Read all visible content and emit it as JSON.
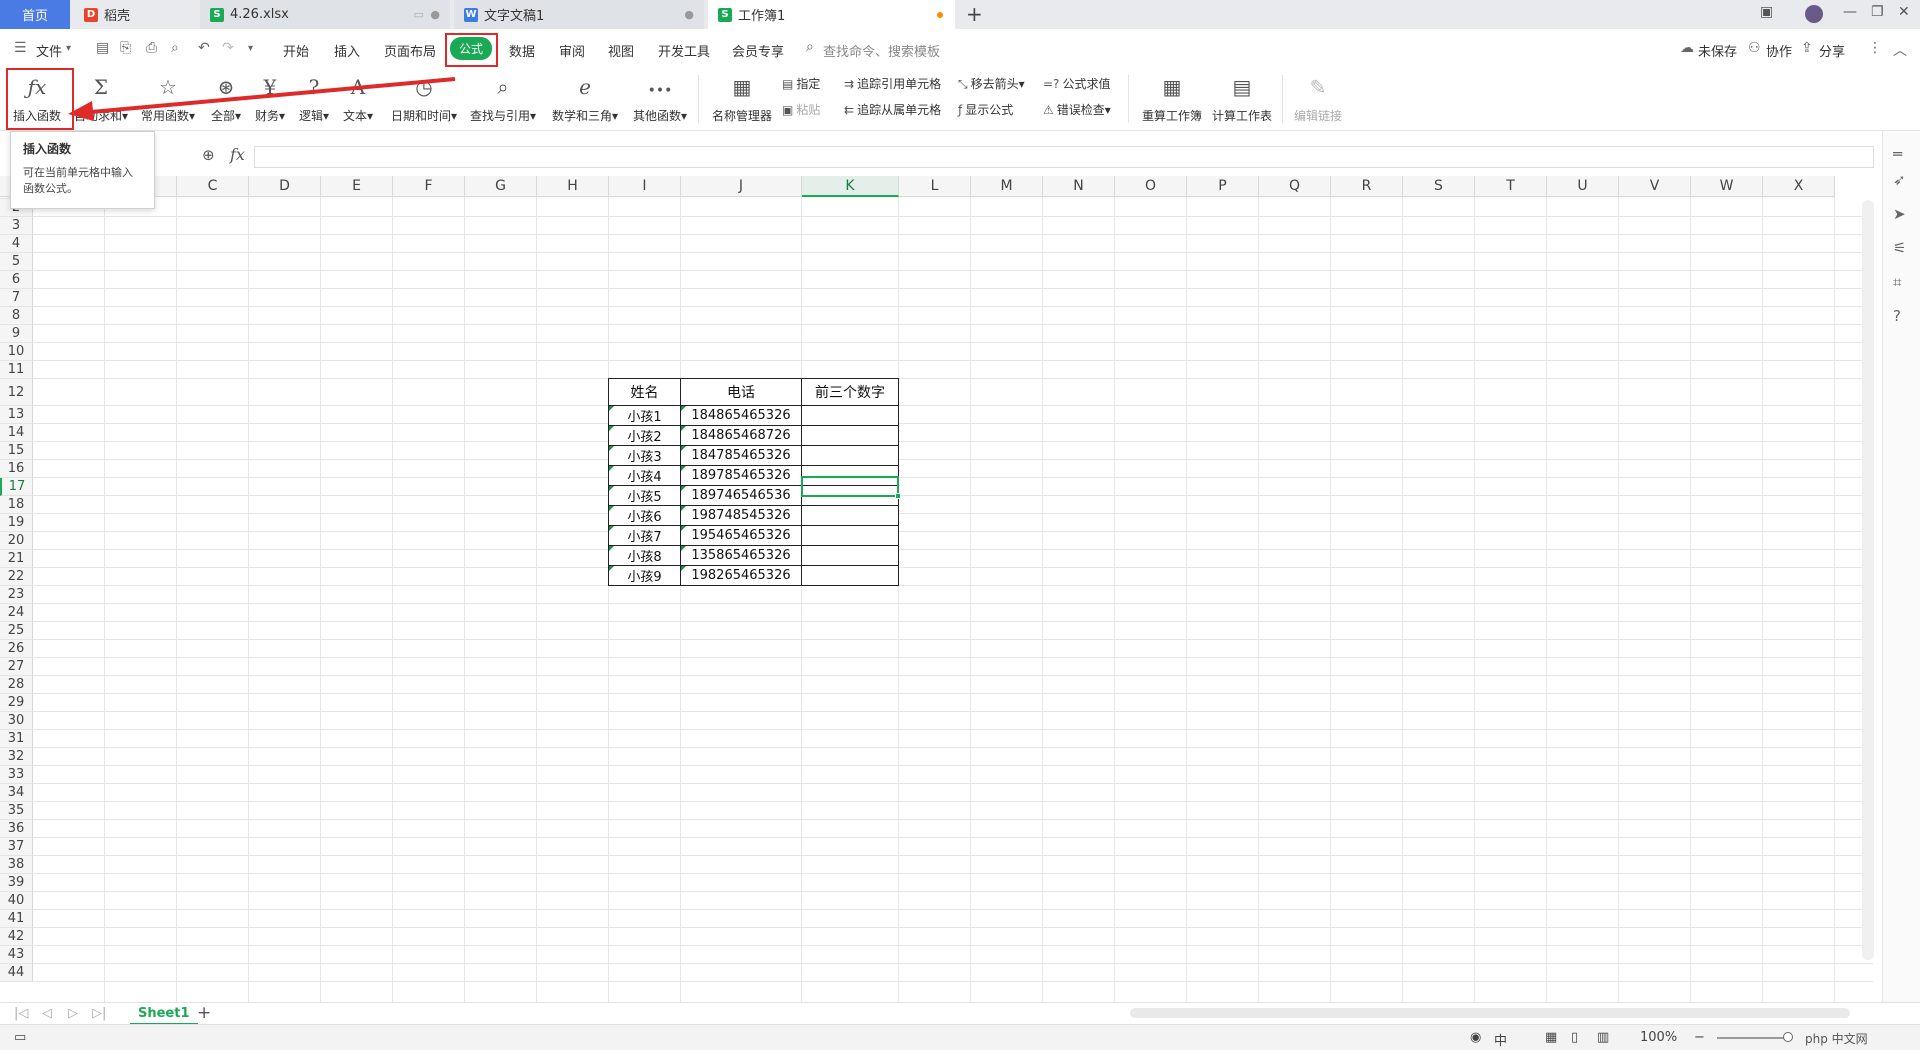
{
  "tabs": {
    "home": "首页",
    "docer": "稻壳",
    "xlsx": "4.26.xlsx",
    "doc": "文字文稿1",
    "workbook": "工作簿1"
  },
  "menu": {
    "file": "文件",
    "items": [
      "开始",
      "插入",
      "页面布局",
      "公式",
      "数据",
      "审阅",
      "视图",
      "开发工具",
      "会员专享"
    ],
    "search_placeholder": "查找命令、搜索模板",
    "unsaved": "未保存",
    "collab": "协作",
    "share": "分享"
  },
  "ribbon": {
    "insert_function": "插入函数",
    "autosum": "自动求和",
    "common": "常用函数",
    "all": "全部",
    "finance": "财务",
    "logic": "逻辑",
    "text": "文本",
    "datetime": "日期和时间",
    "lookup": "查找与引用",
    "math": "数学和三角",
    "other": "其他函数",
    "name_manager": "名称管理器",
    "specify": "指定",
    "paste": "粘贴",
    "trace_precedents": "追踪引用单元格",
    "trace_dependents": "追踪从属单元格",
    "remove_arrows": "移去箭头",
    "show_formulas": "显示公式",
    "evaluate": "公式求值",
    "error_check": "错误检查",
    "recalc_workbook": "重算工作簿",
    "calc_sheet": "计算工作表",
    "edit_links": "编辑链接"
  },
  "tooltip": {
    "title": "插入函数",
    "body": "可在当前单元格中输入函数公式。"
  },
  "formula_bar": {
    "fx": "fx"
  },
  "columns": [
    "C",
    "D",
    "E",
    "F",
    "G",
    "H",
    "I",
    "J",
    "K",
    "L",
    "M",
    "N",
    "O",
    "P",
    "Q",
    "R",
    "S",
    "T",
    "U",
    "V",
    "W",
    "X"
  ],
  "selected_column": "K",
  "rows": [
    "2",
    "3",
    "4",
    "5",
    "6",
    "7",
    "8",
    "9",
    "10",
    "11",
    "12",
    "13",
    "14",
    "15",
    "16",
    "17",
    "18",
    "19",
    "20",
    "21",
    "22",
    "23",
    "24",
    "25",
    "26",
    "27",
    "28",
    "29",
    "30",
    "31",
    "32",
    "33",
    "34",
    "35",
    "36",
    "37",
    "38",
    "39",
    "40",
    "41",
    "42",
    "43",
    "44"
  ],
  "selected_row": "17",
  "table": {
    "headers": [
      "姓名",
      "电话",
      "前三个数字"
    ],
    "rows": [
      [
        "小孩1",
        "184865465326",
        ""
      ],
      [
        "小孩2",
        "184865468726",
        ""
      ],
      [
        "小孩3",
        "184785465326",
        ""
      ],
      [
        "小孩4",
        "189785465326",
        ""
      ],
      [
        "小孩5",
        "189746546536",
        ""
      ],
      [
        "小孩6",
        "198748545326",
        ""
      ],
      [
        "小孩7",
        "195465465326",
        ""
      ],
      [
        "小孩8",
        "135865465326",
        ""
      ],
      [
        "小孩9",
        "198265465326",
        ""
      ]
    ]
  },
  "sheet": {
    "name": "Sheet1"
  },
  "status": {
    "zoom": "100%"
  },
  "watermark": "php 中文网",
  "colors": {
    "accent": "#1aaa55",
    "highlight": "#e02a2a",
    "home_tab": "#4a7be5"
  }
}
